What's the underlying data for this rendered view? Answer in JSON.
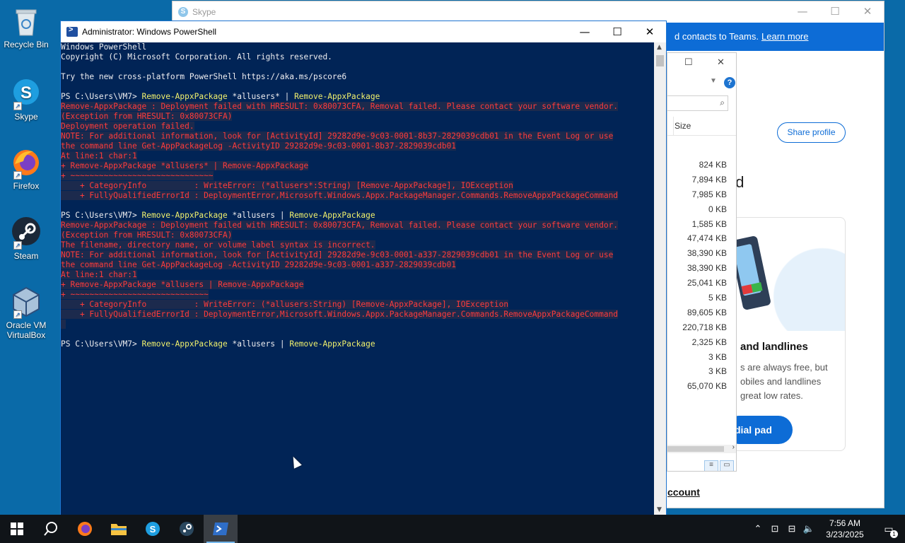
{
  "desktop": {
    "icons": [
      {
        "label": "Recycle Bin"
      },
      {
        "label": "Skype"
      },
      {
        "label": "Firefox"
      },
      {
        "label": "Steam"
      },
      {
        "label": "Oracle VM VirtualBox"
      }
    ]
  },
  "skype": {
    "title": "Skype",
    "banner_text": "d contacts to Teams.",
    "banner_link": "Learn more",
    "share_profile": "Share profile",
    "partial_heading": "ed",
    "card_title": "and landlines",
    "card_text_lines": [
      "s are always free, but",
      "obiles and landlines",
      "great low rates."
    ],
    "dial_pad": "dial pad",
    "account": "ccount"
  },
  "explorer": {
    "size_header": "Size",
    "sizes": [
      "824 KB",
      "7,894 KB",
      "7,985 KB",
      "0 KB",
      "1,585 KB",
      "47,474 KB",
      "38,390 KB",
      "38,390 KB",
      "25,041 KB",
      "5 KB",
      "89,605 KB",
      "220,718 KB",
      "2,325 KB",
      "3 KB",
      "3 KB",
      "65,070 KB"
    ]
  },
  "powershell": {
    "title": "Administrator: Windows PowerShell",
    "lines": [
      {
        "type": "plain",
        "text": "Windows PowerShell"
      },
      {
        "type": "plain",
        "text": "Copyright (C) Microsoft Corporation. All rights reserved."
      },
      {
        "type": "plain",
        "text": ""
      },
      {
        "type": "plain",
        "text": "Try the new cross-platform PowerShell https://aka.ms/pscore6"
      },
      {
        "type": "plain",
        "text": ""
      },
      {
        "type": "prompt",
        "prompt": "PS C:\\Users\\VM7> ",
        "cmd": "Remove-AppxPackage",
        "args": " *allusers* | ",
        "cmd2": "Remove-AppxPackage"
      },
      {
        "type": "error",
        "text": "Remove-AppxPackage : Deployment failed with HRESULT: 0x80073CFA, Removal failed. Please contact your software vendor."
      },
      {
        "type": "error",
        "text": "(Exception from HRESULT: 0x80073CFA)"
      },
      {
        "type": "error",
        "text": "Deployment operation failed."
      },
      {
        "type": "error",
        "text": "NOTE: For additional information, look for [ActivityId] 29282d9e-9c03-0001-8b37-2829039cdb01 in the Event Log or use"
      },
      {
        "type": "error",
        "text": "the command line Get-AppPackageLog -ActivityID 29282d9e-9c03-0001-8b37-2829039cdb01"
      },
      {
        "type": "error",
        "text": "At line:1 char:1"
      },
      {
        "type": "error",
        "text": "+ Remove-AppxPackage *allusers* | Remove-AppxPackage"
      },
      {
        "type": "error",
        "text": "+ ~~~~~~~~~~~~~~~~~~~~~~~~~~~~~~"
      },
      {
        "type": "error",
        "text": "    + CategoryInfo          : WriteError: (*allusers*:String) [Remove-AppxPackage], IOException"
      },
      {
        "type": "error",
        "text": "    + FullyQualifiedErrorId : DeploymentError,Microsoft.Windows.Appx.PackageManager.Commands.RemoveAppxPackageCommand"
      },
      {
        "type": "plain",
        "text": ""
      },
      {
        "type": "prompt",
        "prompt": "PS C:\\Users\\VM7> ",
        "cmd": "Remove-AppxPackage",
        "args": " *allusers | ",
        "cmd2": "Remove-AppxPackage"
      },
      {
        "type": "error",
        "text": "Remove-AppxPackage : Deployment failed with HRESULT: 0x80073CFA, Removal failed. Please contact your software vendor."
      },
      {
        "type": "error",
        "text": "(Exception from HRESULT: 0x80073CFA)"
      },
      {
        "type": "error",
        "text": "The filename, directory name, or volume label syntax is incorrect."
      },
      {
        "type": "error",
        "text": "NOTE: For additional information, look for [ActivityId] 29282d9e-9c03-0001-a337-2829039cdb01 in the Event Log or use"
      },
      {
        "type": "error",
        "text": "the command line Get-AppPackageLog -ActivityID 29282d9e-9c03-0001-a337-2829039cdb01"
      },
      {
        "type": "error",
        "text": "At line:1 char:1"
      },
      {
        "type": "error",
        "text": "+ Remove-AppxPackage *allusers | Remove-AppxPackage"
      },
      {
        "type": "error",
        "text": "+ ~~~~~~~~~~~~~~~~~~~~~~~~~~~~~"
      },
      {
        "type": "error",
        "text": "    + CategoryInfo          : WriteError: (*allusers:String) [Remove-AppxPackage], IOException"
      },
      {
        "type": "error",
        "text": "    + FullyQualifiedErrorId : DeploymentError,Microsoft.Windows.Appx.PackageManager.Commands.RemoveAppxPackageCommand"
      },
      {
        "type": "error",
        "text": " "
      },
      {
        "type": "plain",
        "text": ""
      },
      {
        "type": "prompt",
        "prompt": "PS C:\\Users\\VM7> ",
        "cmd": "Remove-AppxPackage",
        "args": " *allusers | ",
        "cmd2": "Remove-AppxPackage"
      }
    ]
  },
  "taskbar": {
    "time": "7:56 AM",
    "date": "3/23/2025",
    "notification_count": "1"
  },
  "colors": {
    "ps_bg": "#012456",
    "error": "#ff3b3b",
    "cmd": "#f1f06d",
    "skype_blue": "#0d6cd6"
  }
}
